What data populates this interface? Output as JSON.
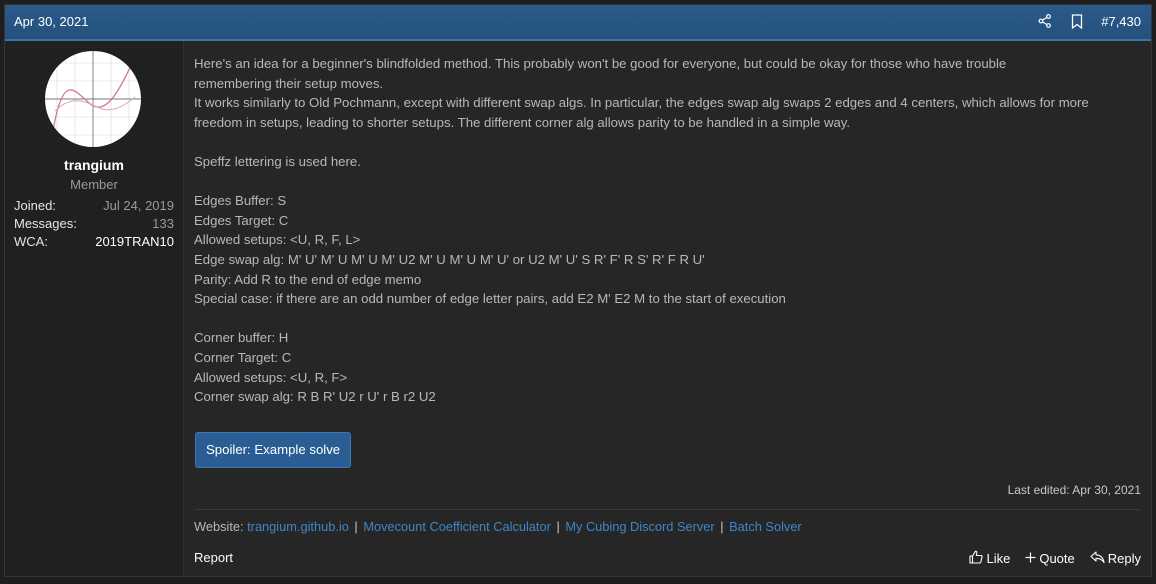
{
  "post": {
    "date": "Apr 30, 2021",
    "number": "#7,430",
    "icons": {
      "share": "share-icon",
      "bookmark": "bookmark-icon"
    }
  },
  "user": {
    "name": "trangium",
    "title": "Member",
    "stats": [
      {
        "label": "Joined:",
        "value": "Jul 24, 2019"
      },
      {
        "label": "Messages:",
        "value": "133"
      },
      {
        "label": "WCA:",
        "value": "2019TRAN10"
      }
    ]
  },
  "message": {
    "lines": [
      "Here's an idea for a beginner's blindfolded method. This probably won't be good for everyone, but could be okay for those who have trouble",
      "remembering their setup moves.",
      "It works similarly to Old Pochmann, except with different swap algs. In particular, the edges swap alg swaps 2 edges and 4 centers, which allows for more",
      "freedom in setups, leading to shorter setups. The different corner alg allows parity to be handled in a simple way.",
      "",
      "Speffz lettering is used here.",
      "",
      "Edges Buffer: S",
      "Edges Target: C",
      "Allowed setups: <U, R, F, L>",
      "Edge swap alg: M' U' M' U M' U M' U2 M' U M' U M' U' or U2 M' U' S R' F' R S' R' F R U'",
      "Parity: Add R to the end of edge memo",
      "Special case: if there are an odd number of edge letter pairs, add E2 M' E2 M to the start of execution",
      "",
      "Corner buffer: H",
      "Corner Target: C",
      "Allowed setups: <U, R, F>",
      "Corner swap alg: R B R' U2 r U' r B r2 U2"
    ],
    "spoiler_label": "Spoiler: Example solve",
    "last_edited": "Last edited: Apr 30, 2021"
  },
  "signature": {
    "prefix": "Website:",
    "links": [
      "trangium.github.io",
      "Movecount Coefficient Calculator",
      "My Cubing Discord Server",
      "Batch Solver"
    ],
    "separator": "|"
  },
  "footer": {
    "report": "Report",
    "like": "Like",
    "quote": "Quote",
    "reply": "Reply"
  },
  "colors": {
    "header": "#2b5b8b",
    "link": "#3f86c9",
    "spoiler": "#2a5d93"
  }
}
